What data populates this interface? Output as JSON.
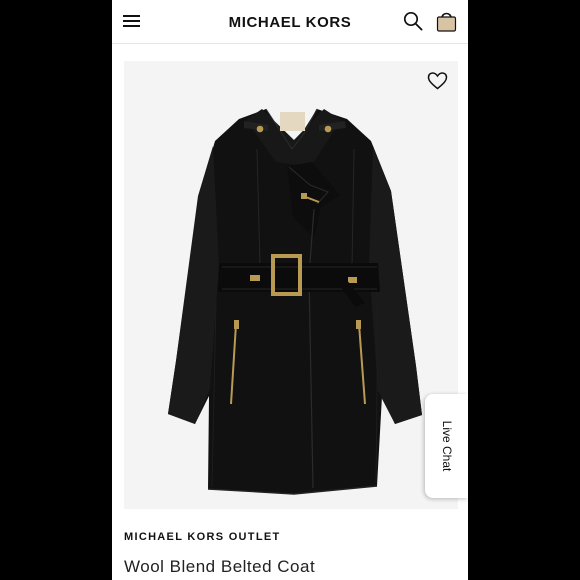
{
  "header": {
    "brand": "MICHAEL KORS",
    "menu_icon": "hamburger-menu-icon",
    "search_icon": "search-icon",
    "bag_icon": "shopping-bag-icon"
  },
  "product": {
    "favorite_icon": "heart-icon",
    "image_icon": "black-belted-wool-coat",
    "store": "MICHAEL KORS OUTLET",
    "title": "Wool Blend Belted Coat"
  },
  "live_chat": {
    "label": "Live Chat"
  },
  "colors": {
    "background": "#000000",
    "page": "#ffffff",
    "image_background": "#f4f4f4",
    "bag": "#d8c3a5",
    "coat": "#111111",
    "hardware": "#b99a53"
  }
}
